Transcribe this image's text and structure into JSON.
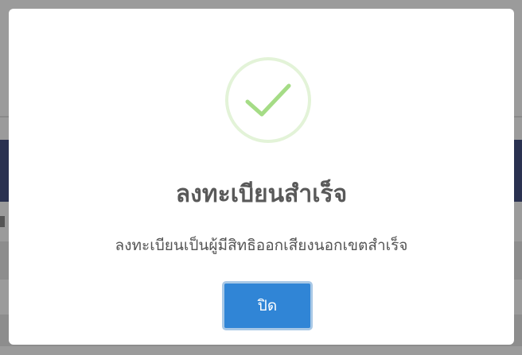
{
  "modal": {
    "icon": "success-check-icon",
    "title": "ลงทะเบียนสำเร็จ",
    "message": "ลงทะเบียนเป็นผู้มีสิทธิออกเสียงนอกเขตสำเร็จ",
    "close_label": "ปิด"
  },
  "colors": {
    "overlay": "#9b9b9b",
    "navbar": "#2a3150",
    "check": "#a5dc86",
    "check_ring": "#e3f3d8",
    "button": "#3085d6",
    "title_text": "#595959"
  }
}
